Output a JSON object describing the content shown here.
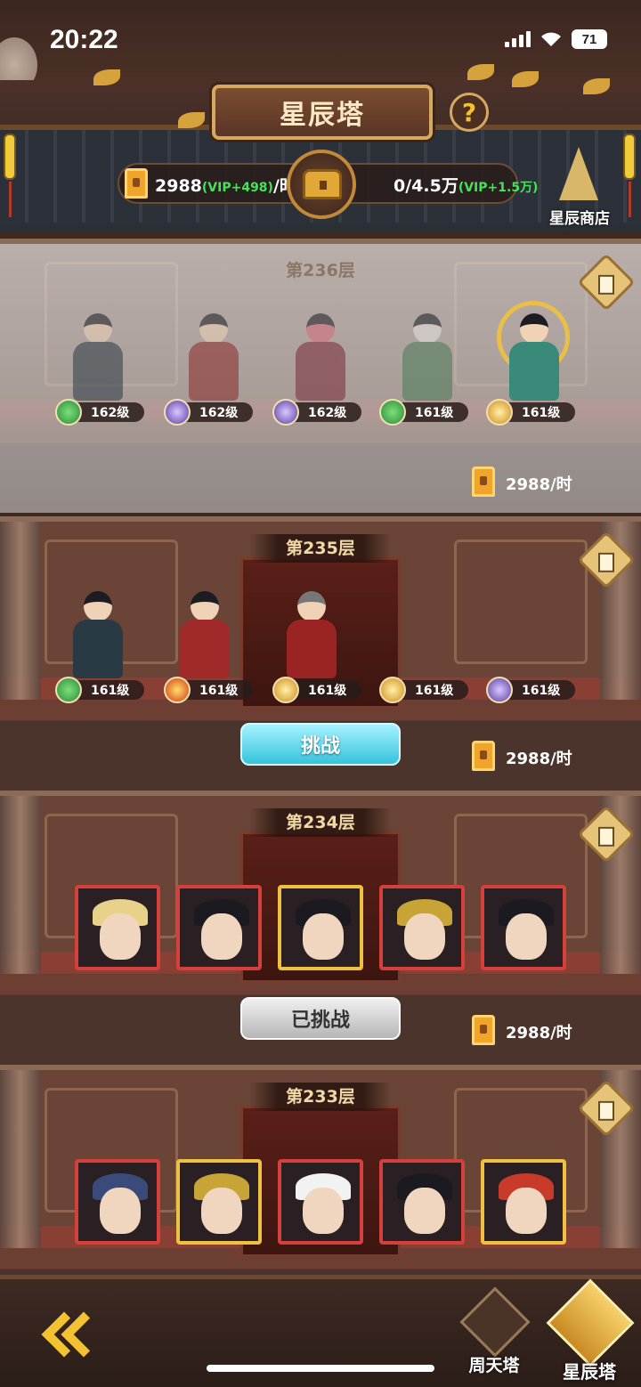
{
  "status_bar": {
    "time": "20:22",
    "battery": "71"
  },
  "header": {
    "title": "星辰塔",
    "help": "?",
    "income_value": "2988",
    "income_vip": "(VIP+498)",
    "income_unit": "/时",
    "storage_value": "0/4.5万",
    "storage_vip": "(VIP+1.5万)",
    "shop_label": "星辰商店"
  },
  "floors": [
    {
      "label": "第236层",
      "state": "locked-fog",
      "levels": [
        "162级",
        "162级",
        "162级",
        "161级",
        "161级"
      ],
      "factions": [
        "green",
        "purple",
        "purple",
        "green",
        "gold"
      ],
      "reward": "2988/时"
    },
    {
      "label": "第235层",
      "state": "current",
      "levels": [
        "161级",
        "161级",
        "161级",
        "161级",
        "161级"
      ],
      "factions": [
        "green",
        "fire",
        "gold",
        "gold",
        "purple"
      ],
      "reward": "2988/时",
      "button": "挑战"
    },
    {
      "label": "第234层",
      "state": "cleared",
      "reward": "2988/时",
      "button": "已挑战"
    },
    {
      "label": "第233层",
      "state": "cleared"
    }
  ],
  "bottom_nav": {
    "zhoutian": "周天塔",
    "xingchen": "星辰塔"
  },
  "colors": {
    "accent_gold": "#f2c230",
    "vip_green": "#46e25a",
    "challenge_cyan": "#35c3dc"
  }
}
